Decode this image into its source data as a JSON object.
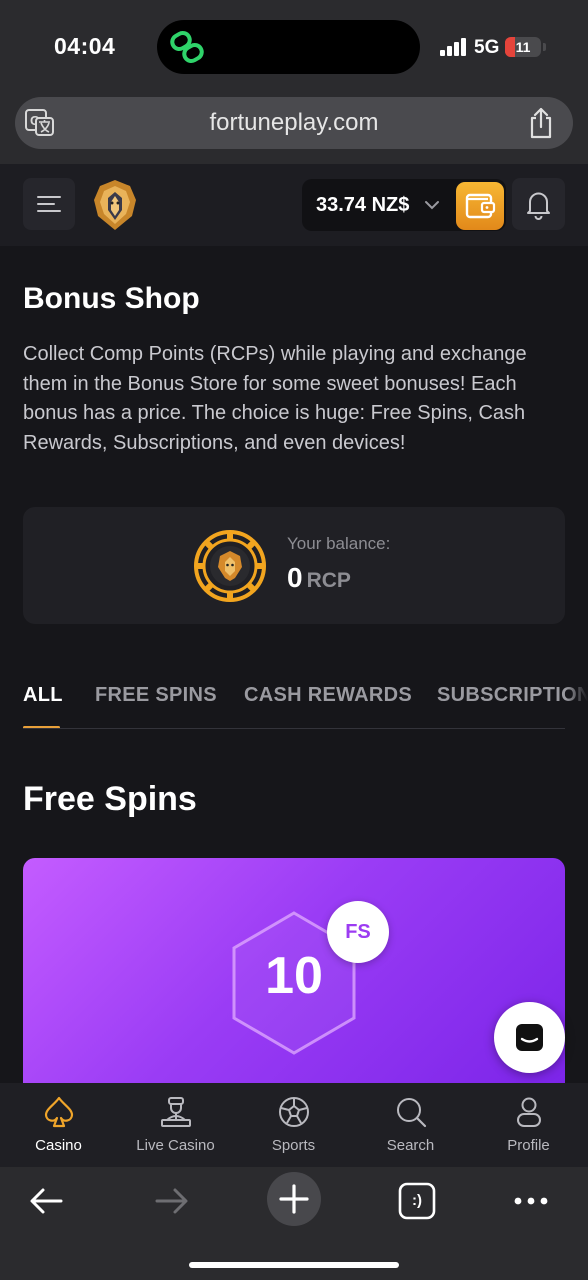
{
  "status_bar": {
    "time": "04:04",
    "network": "5G",
    "battery_level": "11",
    "battery_color": "#e5443b"
  },
  "browser": {
    "url": "fortuneplay.com"
  },
  "header": {
    "balance": "33.74 NZ$",
    "accent_color": "#f0a52a"
  },
  "main": {
    "title": "Bonus Shop",
    "description": "Collect Comp Points (RCPs) while playing and exchange them in the Bonus Store for some sweet bonuses! Each bonus has a price. The choice is huge: Free Spins, Cash Rewards, Subscriptions, and even devices!",
    "balance_card": {
      "label": "Your balance:",
      "amount": "0",
      "unit": "RCP"
    },
    "tabs": [
      {
        "label": "ALL",
        "active": true
      },
      {
        "label": "FREE SPINS",
        "active": false
      },
      {
        "label": "CASH REWARDS",
        "active": false
      },
      {
        "label": "SUBSCRIPTIONS",
        "active": false
      }
    ],
    "section_title": "Free Spins",
    "bonus_card": {
      "value": "10",
      "badge": "FS",
      "gradient_start": "#c45cff",
      "gradient_end": "#7b24e8"
    }
  },
  "bottom_nav": {
    "items": [
      {
        "label": "Casino",
        "icon": "spade-icon",
        "active": true
      },
      {
        "label": "Live Casino",
        "icon": "dealer-icon",
        "active": false
      },
      {
        "label": "Sports",
        "icon": "soccer-ball-icon",
        "active": false
      },
      {
        "label": "Search",
        "icon": "search-icon",
        "active": false
      },
      {
        "label": "Profile",
        "icon": "profile-icon",
        "active": false
      }
    ]
  },
  "browser_toolbar": {
    "tabs_icon_text": ":)"
  }
}
